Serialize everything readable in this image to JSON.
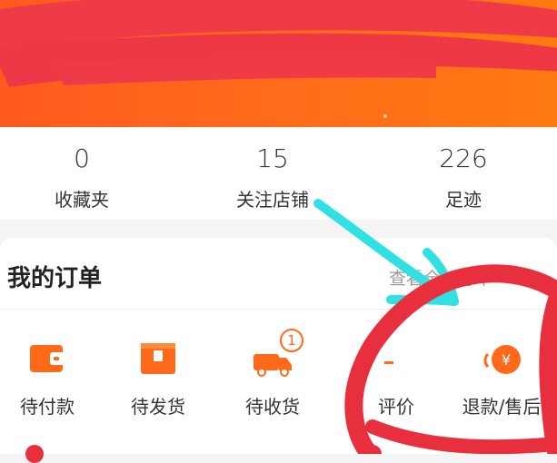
{
  "stats": [
    {
      "value": "0",
      "label": "收藏夹"
    },
    {
      "value": "15",
      "label": "关注店铺"
    },
    {
      "value": "226",
      "label": "足迹"
    }
  ],
  "orders": {
    "title": "我的订单",
    "view_all": "查看全部订单",
    "items": [
      {
        "label": "待付款",
        "icon": "wallet-icon"
      },
      {
        "label": "待发货",
        "icon": "package-icon"
      },
      {
        "label": "待收货",
        "icon": "truck-icon",
        "badge": "1"
      },
      {
        "label": "评价",
        "icon": "review-icon"
      },
      {
        "label": "退款/售后",
        "icon": "refund-icon"
      }
    ]
  },
  "colors": {
    "brand_orange": "#ff5a1f",
    "icon_orange": "#ff6a1a",
    "annotation_red": "#e82f3e",
    "annotation_cyan": "#31e0e3"
  }
}
